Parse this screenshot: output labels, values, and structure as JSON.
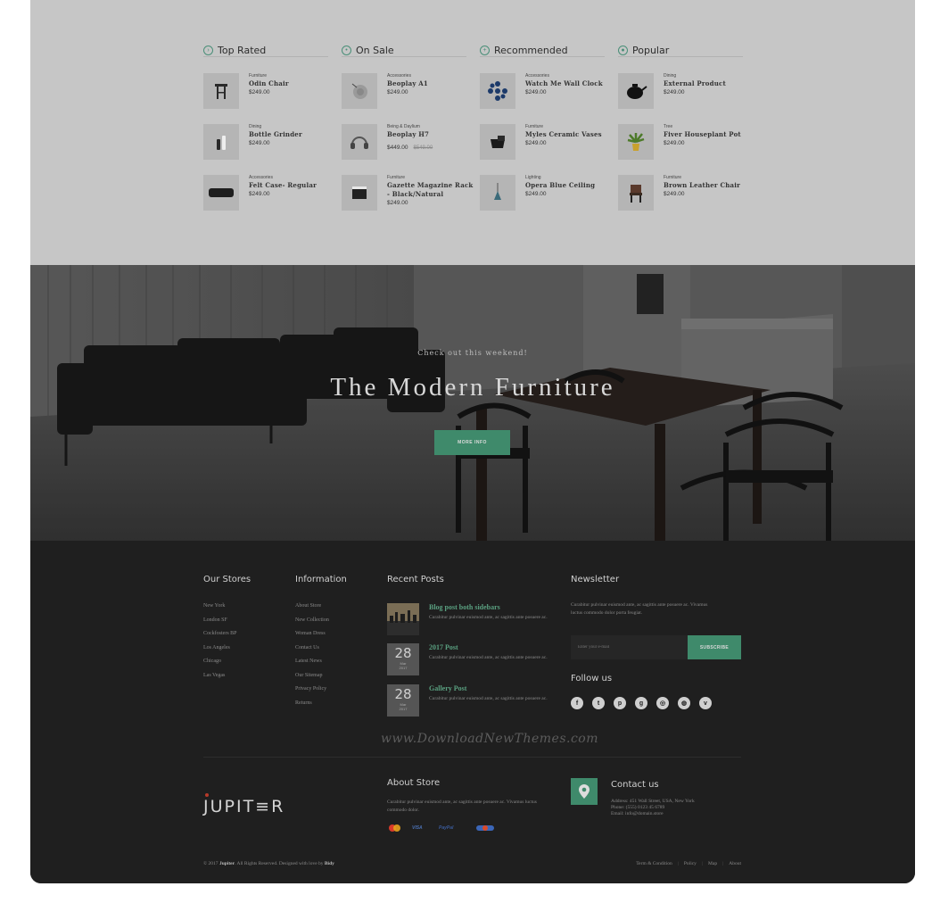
{
  "products": {
    "columns": [
      {
        "title": "Top Rated",
        "icon": "chevron-circle-icon",
        "items": [
          {
            "category": "Furniture",
            "name": "Odin Chair",
            "price": "$249.00",
            "thumb": "stool"
          },
          {
            "category": "Dining",
            "name": "Bottle Grinder",
            "price": "$249.00",
            "thumb": "bottles"
          },
          {
            "category": "Accessories",
            "name": "Felt Case- Regular",
            "price": "$249.00",
            "thumb": "case"
          }
        ]
      },
      {
        "title": "On Sale",
        "icon": "tag-circle-icon",
        "items": [
          {
            "category": "Accessories",
            "name": "Beoplay A1",
            "price": "$249.00",
            "thumb": "speaker"
          },
          {
            "category": "Being & Daylium",
            "name": "Beoplay H7",
            "price": "$449.00",
            "old_price": "$549.00",
            "thumb": "headphones"
          },
          {
            "category": "Furniture",
            "name": "Gazette Magazine Rack - Black/Natural",
            "price": "$249.00",
            "thumb": "rack"
          }
        ]
      },
      {
        "title": "Recommended",
        "icon": "plus-circle-icon",
        "items": [
          {
            "category": "Accessories",
            "name": "Watch Me Wall Clock",
            "price": "$249.00",
            "thumb": "clock"
          },
          {
            "category": "Furniture",
            "name": "Myles Ceramic Vases",
            "price": "$249.00",
            "thumb": "vase"
          },
          {
            "category": "Lighting",
            "name": "Opera Blue Ceiling",
            "price": "$249.00",
            "thumb": "lamp"
          }
        ]
      },
      {
        "title": "Popular",
        "icon": "dot-circle-icon",
        "items": [
          {
            "category": "Dining",
            "name": "External Product",
            "price": "$249.00",
            "thumb": "kettle"
          },
          {
            "category": "Tree",
            "name": "Fiver Houseplant Pot",
            "price": "$249.00",
            "thumb": "plant"
          },
          {
            "category": "Furniture",
            "name": "Brown Leather Chair",
            "price": "$249.00",
            "thumb": "chair"
          }
        ]
      }
    ]
  },
  "hero": {
    "subtitle": "Check out this weekend!",
    "title": "The Modern Furniture",
    "button_label": "MORE INFO"
  },
  "footer": {
    "stores": {
      "heading": "Our Stores",
      "items": [
        "New York",
        "London SF",
        "Cockfosters BP",
        "Los Angeles",
        "Chicago",
        "Las Vegas"
      ]
    },
    "information": {
      "heading": "Information",
      "items": [
        "About Store",
        "New Collection",
        "Woman Dress",
        "Contact Us",
        "Latest News",
        "Our Sitemap",
        "Privacy Policy",
        "Returns"
      ]
    },
    "recent_posts": {
      "heading": "Recent Posts",
      "posts": [
        {
          "title": "Blog post both sidebars",
          "excerpt": "Curabitur pulvinar euismod ante, ac sagittis ante posuere ac.",
          "day": "",
          "month": "",
          "year": ""
        },
        {
          "title": "2017 Post",
          "excerpt": "Curabitur pulvinar euismod ante, ac sagittis ante posuere ac.",
          "day": "28",
          "month": "Mar",
          "year": "2017"
        },
        {
          "title": "Gallery Post",
          "excerpt": "Curabitur pulvinar euismod ante, ac sagittis ante posuere ac.",
          "day": "28",
          "month": "Mar",
          "year": "2017"
        }
      ]
    },
    "newsletter": {
      "heading": "Newsletter",
      "text": "Curabitur pulvinar euismod ante, ac sagittis ante posuere ac. Vivamus luctus commodo dolor porta feugiat.",
      "placeholder": "Enter your e-mail",
      "button_label": "SUBSCRIBE"
    },
    "follow": {
      "heading": "Follow us",
      "icons": [
        {
          "name": "facebook-icon",
          "glyph": "f"
        },
        {
          "name": "twitter-icon",
          "glyph": "t"
        },
        {
          "name": "pinterest-icon",
          "glyph": "p"
        },
        {
          "name": "google-plus-icon",
          "glyph": "g"
        },
        {
          "name": "instagram-icon",
          "glyph": "◎"
        },
        {
          "name": "dribbble-icon",
          "glyph": "◍"
        },
        {
          "name": "vimeo-icon",
          "glyph": "v"
        }
      ]
    },
    "watermark": "www.DownloadNewThemes.com",
    "logo": "JUPIT≡R",
    "about": {
      "heading": "About Store",
      "text": "Curabitur pulvinar euismod ante, ac sagittis ante posuere ac. Vivamus luctus commodo dolor.",
      "payments": [
        "MasterCard",
        "VISA",
        "PayPal",
        "Discover"
      ]
    },
    "contact": {
      "heading": "Contact us",
      "address": "Address: 451 Wall Street, USA, New York",
      "phone": "Phone: (555) 0123 45 6789",
      "email": "Email: info@domain.store"
    },
    "copyright_pre": "© 2017 ",
    "copyright_brand": "Jupiter",
    "copyright_mid": ". All Rights Reserved. Designed with love by ",
    "copyright_author": "Bidy",
    "bottom_links": [
      "Term & Condition",
      "Policy",
      "Map",
      "About"
    ]
  },
  "colors": {
    "accent": "#3f8a6b",
    "dark": "#1f1f1f",
    "product_bg": "#c6c6c6"
  }
}
